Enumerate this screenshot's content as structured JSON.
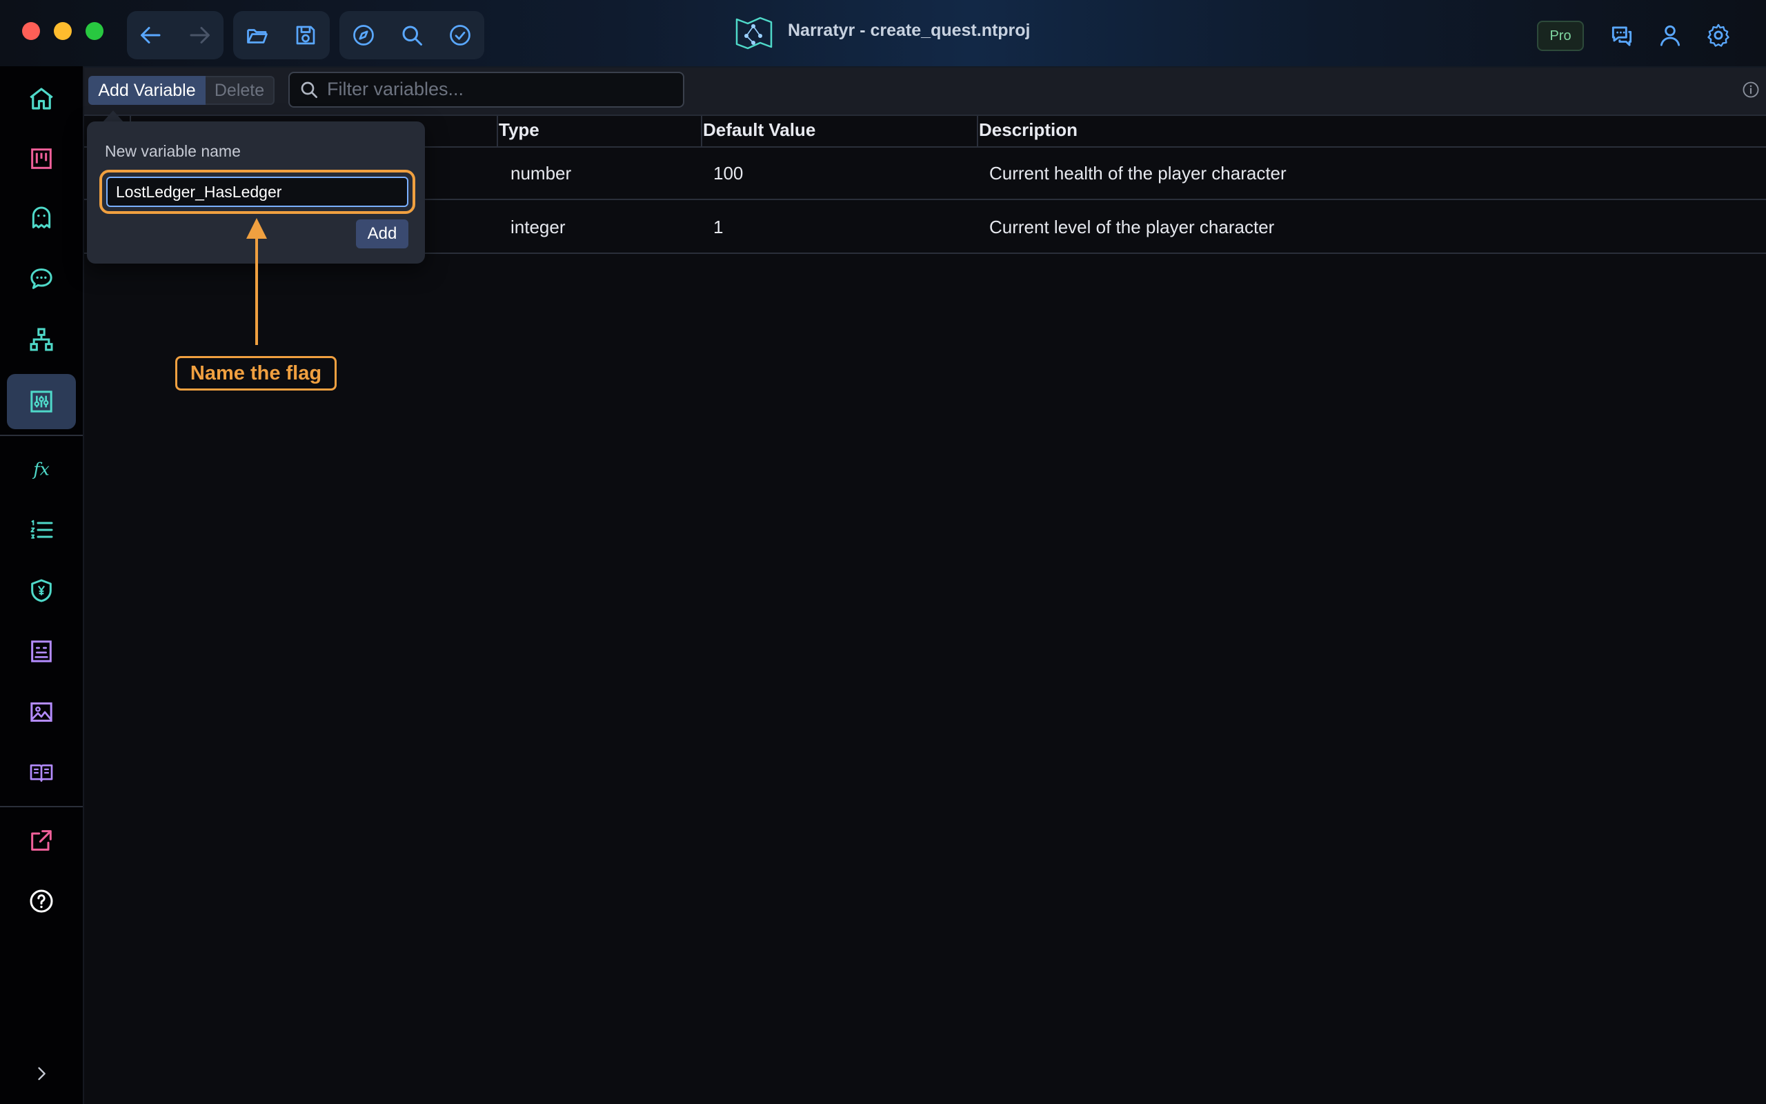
{
  "window": {
    "title": "Narratyr - create_quest.ntproj",
    "badge": "Pro"
  },
  "toolbar": {
    "add_label": "Add Variable",
    "delete_label": "Delete",
    "filter_placeholder": "Filter variables..."
  },
  "table": {
    "columns": [
      "Type",
      "Default Value",
      "Description"
    ],
    "rows": [
      {
        "type": "number",
        "default": "100",
        "description": "Current health of the player character"
      },
      {
        "type": "integer",
        "default": "1",
        "description": "Current level of the player character"
      }
    ]
  },
  "popup": {
    "label": "New variable name",
    "value": "LostLedger_HasLedger",
    "add_label": "Add"
  },
  "annotation": {
    "text": "Name the flag"
  },
  "sidebar": {
    "items": [
      "home-icon",
      "board-icon",
      "ghost-icon",
      "chat-icon",
      "hierarchy-icon",
      "sliders-icon",
      "function-icon",
      "list-icon",
      "shield-yen-icon",
      "document-icon",
      "image-icon",
      "book-icon",
      "export-icon",
      "help-icon",
      "expand-icon"
    ],
    "active": "sliders-icon"
  },
  "colors": {
    "accent": "#5aa8ff",
    "annotation": "#f0a040",
    "sidebar_icon": "#4fd9c9"
  }
}
